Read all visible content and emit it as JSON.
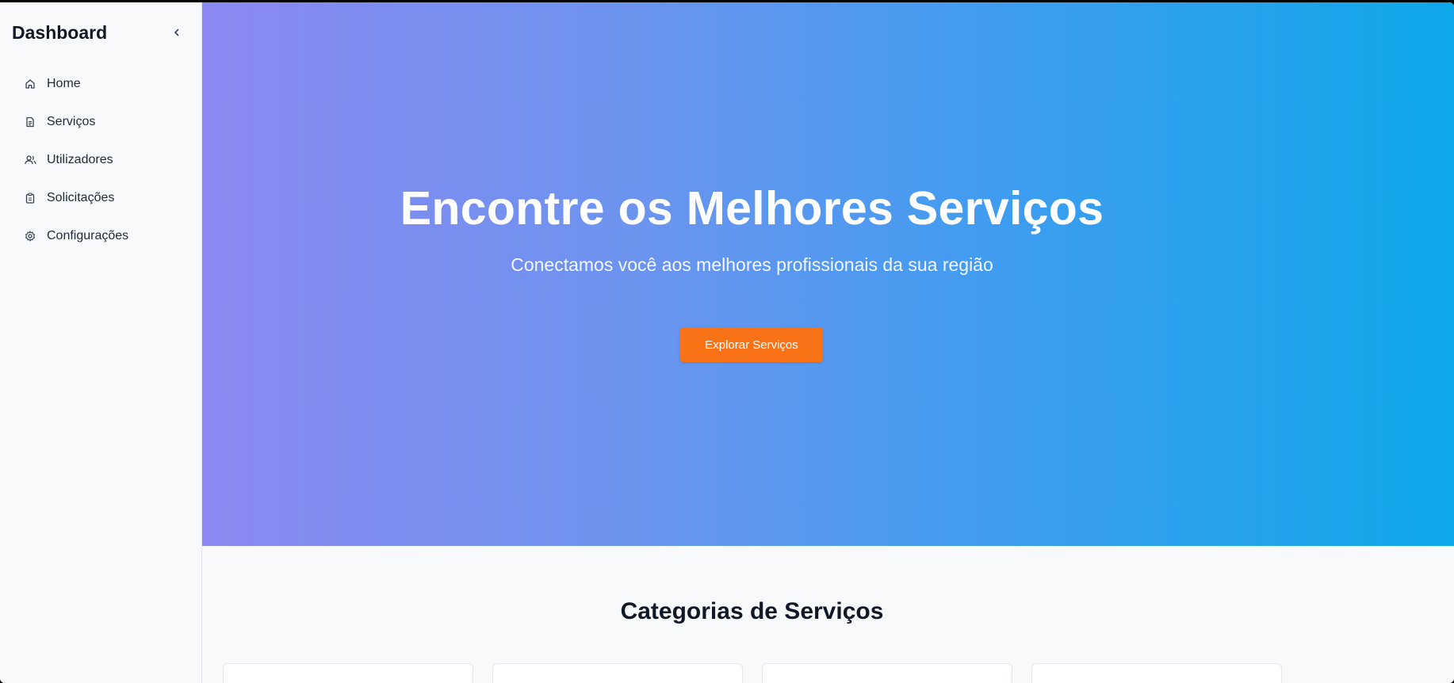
{
  "sidebar": {
    "title": "Dashboard",
    "collapse_icon": "chevron-left-icon",
    "items": [
      {
        "label": "Home",
        "icon": "home-icon"
      },
      {
        "label": "Serviços",
        "icon": "document-icon"
      },
      {
        "label": "Utilizadores",
        "icon": "users-icon"
      },
      {
        "label": "Solicitações",
        "icon": "clipboard-icon"
      },
      {
        "label": "Configurações",
        "icon": "gear-icon"
      }
    ]
  },
  "hero": {
    "title": "Encontre os Melhores Serviços",
    "subtitle": "Conectamos você aos melhores profissionais da sua região",
    "button_label": "Explorar Serviços",
    "gradient_start": "#8b88f2",
    "gradient_end": "#0ea7e9",
    "button_color": "#f97316"
  },
  "categories": {
    "title": "Categorias de Serviços"
  }
}
